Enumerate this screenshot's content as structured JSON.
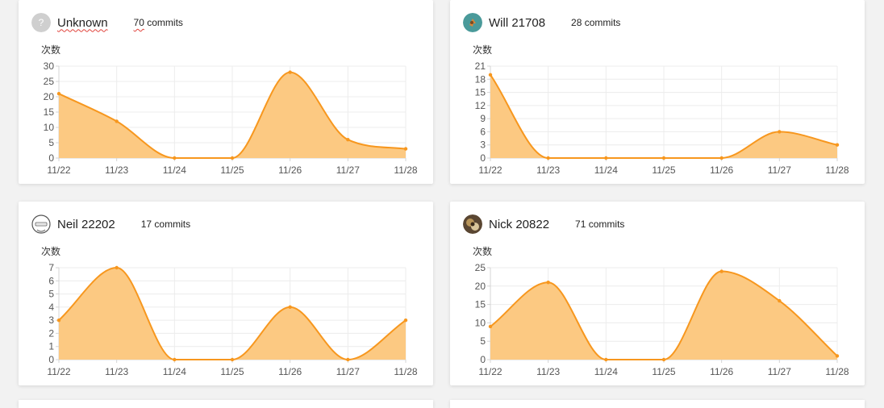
{
  "colors": {
    "line": "#f7971e",
    "fill": "#fcc982",
    "grid": "#ececec",
    "axis": "#d4d4d4",
    "tick": "#555555"
  },
  "cards": [
    {
      "name": "Unknown",
      "commits_count": "70",
      "commits_label": "commits",
      "avatar": "question-mark-icon",
      "unknown": true
    },
    {
      "name": "Will 21708",
      "commits_count": "28",
      "commits_label": "commits",
      "avatar": "will-avatar"
    },
    {
      "name": "Neil 22202",
      "commits_count": "17",
      "commits_label": "commits",
      "avatar": "neil-avatar"
    },
    {
      "name": "Nick 20822",
      "commits_count": "71",
      "commits_label": "commits",
      "avatar": "nick-avatar"
    }
  ],
  "chart_data": [
    {
      "type": "area",
      "ylabel": "次数",
      "x": [
        "11/22",
        "11/23",
        "11/24",
        "11/25",
        "11/26",
        "11/27",
        "11/28"
      ],
      "values": [
        21,
        12,
        0,
        0,
        28,
        6,
        3
      ],
      "ylim": [
        0,
        30
      ],
      "yticks": [
        0,
        5,
        10,
        15,
        20,
        25,
        30
      ]
    },
    {
      "type": "area",
      "ylabel": "次数",
      "x": [
        "11/22",
        "11/23",
        "11/24",
        "11/25",
        "11/26",
        "11/27",
        "11/28"
      ],
      "values": [
        19,
        0,
        0,
        0,
        0,
        6,
        3
      ],
      "ylim": [
        0,
        21
      ],
      "yticks": [
        0,
        3,
        6,
        9,
        12,
        15,
        18,
        21
      ]
    },
    {
      "type": "area",
      "ylabel": "次数",
      "x": [
        "11/22",
        "11/23",
        "11/24",
        "11/25",
        "11/26",
        "11/27",
        "11/28"
      ],
      "values": [
        3,
        7,
        0,
        0,
        4,
        0,
        3
      ],
      "ylim": [
        0,
        7
      ],
      "yticks": [
        0,
        1,
        2,
        3,
        4,
        5,
        6,
        7
      ]
    },
    {
      "type": "area",
      "ylabel": "次数",
      "x": [
        "11/22",
        "11/23",
        "11/24",
        "11/25",
        "11/26",
        "11/27",
        "11/28"
      ],
      "values": [
        9,
        21,
        0,
        0,
        24,
        16,
        1
      ],
      "ylim": [
        0,
        25
      ],
      "yticks": [
        0,
        5,
        10,
        15,
        20,
        25
      ]
    }
  ]
}
